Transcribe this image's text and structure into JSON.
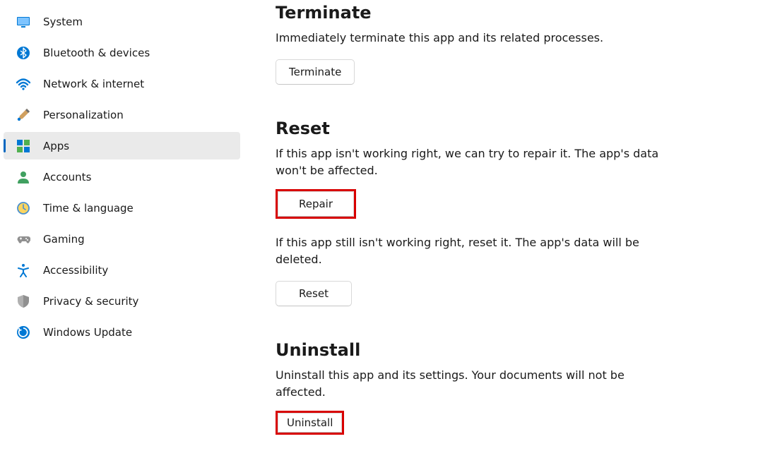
{
  "sidebar": {
    "items": [
      {
        "label": "System"
      },
      {
        "label": "Bluetooth & devices"
      },
      {
        "label": "Network & internet"
      },
      {
        "label": "Personalization"
      },
      {
        "label": "Apps"
      },
      {
        "label": "Accounts"
      },
      {
        "label": "Time & language"
      },
      {
        "label": "Gaming"
      },
      {
        "label": "Accessibility"
      },
      {
        "label": "Privacy & security"
      },
      {
        "label": "Windows Update"
      }
    ]
  },
  "sections": {
    "terminate": {
      "heading": "Terminate",
      "desc": "Immediately terminate this app and its related processes.",
      "button": "Terminate"
    },
    "reset": {
      "heading": "Reset",
      "desc1": "If this app isn't working right, we can try to repair it. The app's data won't be affected.",
      "repair_button": "Repair",
      "desc2": "If this app still isn't working right, reset it. The app's data will be deleted.",
      "reset_button": "Reset"
    },
    "uninstall": {
      "heading": "Uninstall",
      "desc": "Uninstall this app and its settings. Your documents will not be affected.",
      "button": "Uninstall"
    }
  }
}
